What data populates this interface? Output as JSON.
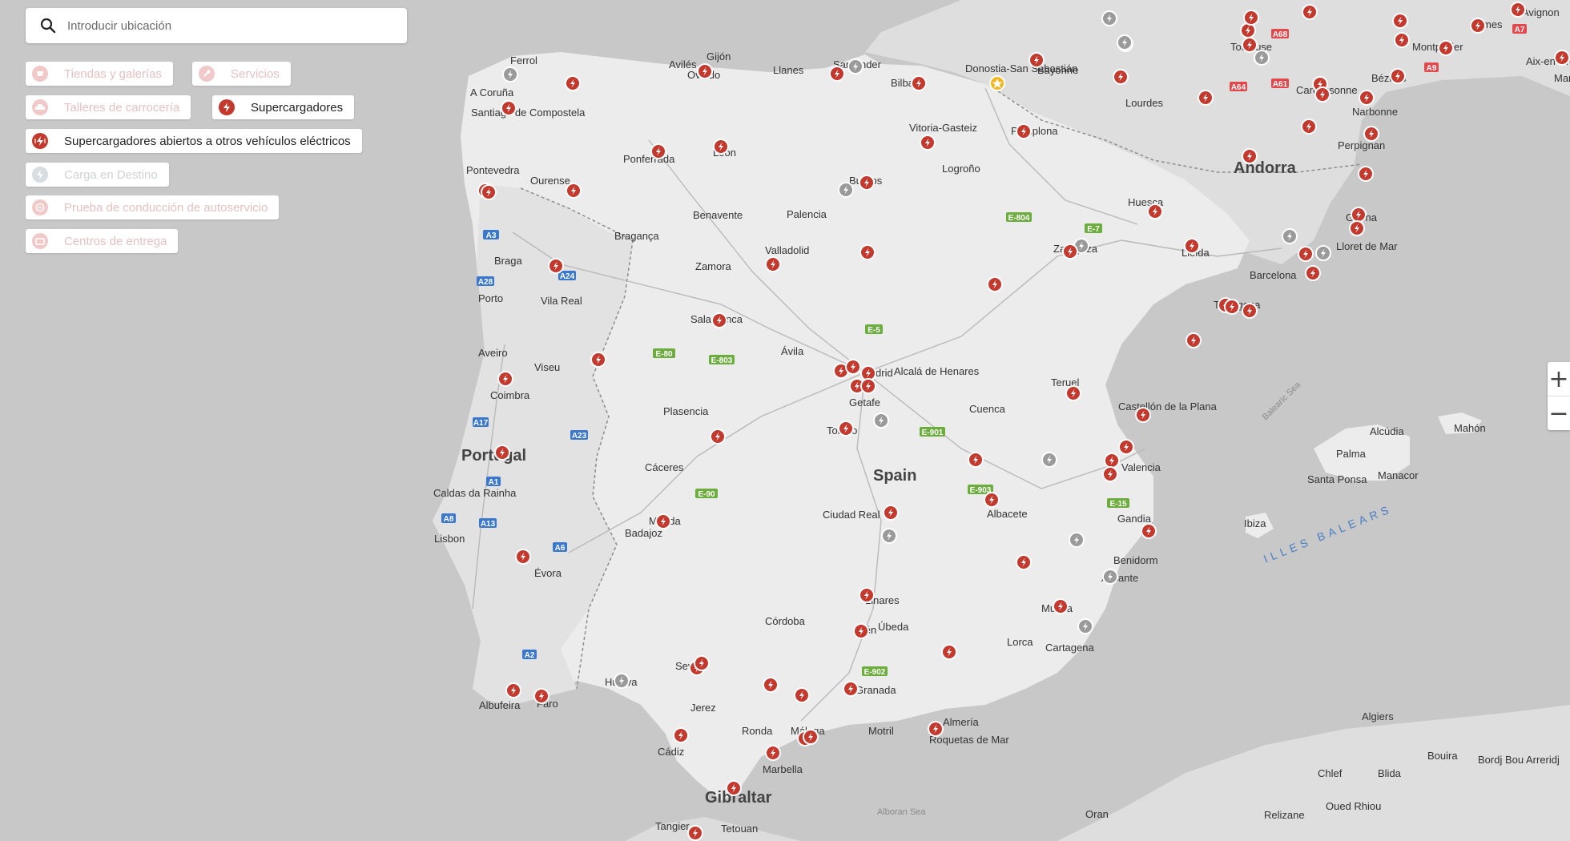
{
  "search": {
    "placeholder": "Introducir ubicación"
  },
  "filters": [
    {
      "label": "Tiendas y galerías",
      "active": false,
      "icon": "store-icon"
    },
    {
      "label": "Servicios",
      "active": false,
      "icon": "wrench-icon"
    },
    {
      "label": "Talleres de carrocería",
      "active": false,
      "icon": "car-body-icon"
    },
    {
      "label": "Supercargadores",
      "active": true,
      "icon": "bolt-icon"
    },
    {
      "label": "Supercargadores abiertos a otros vehículos eléctricos",
      "active": true,
      "icon": "bolt-open-icon"
    },
    {
      "label": "Carga en Destino",
      "active": false,
      "icon": "plug-icon"
    },
    {
      "label": "Prueba de conducción de autoservicio",
      "active": false,
      "icon": "steering-wheel-icon"
    },
    {
      "label": "Centros de entrega",
      "active": false,
      "icon": "delivery-icon"
    }
  ],
  "zoom": {
    "in": "+",
    "out": "−"
  },
  "colors": {
    "supercharger": "#c3392d",
    "destination": "#9a9a9a",
    "selected": "#f2b51b"
  },
  "map_labels": {
    "regions": [
      "Spain",
      "Portugal",
      "Andorra",
      "Gibraltar"
    ],
    "cities": [
      "A Coruña",
      "Ferrol",
      "Avilés",
      "Gijón",
      "Oviedo",
      "Llanes",
      "Santander",
      "Bilbao",
      "Donostia-San Sebastián",
      "Bayonne",
      "Vitoria-Gasteiz",
      "Pamplona",
      "Logroño",
      "Burgos",
      "Palencia",
      "Valladolid",
      "Zamora",
      "Salamanca",
      "Ávila",
      "Madrid",
      "Alcalá de Henares",
      "Getafe",
      "Toledo",
      "Cuenca",
      "Teruel",
      "Zaragoza",
      "Huesca",
      "Lleida",
      "Barcelona",
      "Tarragona",
      "Girona",
      "Lloret de Mar",
      "Perpignan",
      "Narbonne",
      "Montpellier",
      "Toulouse",
      "Carcassonne",
      "Béziers",
      "Lourdes",
      "Castellón de la Plana",
      "Valencia",
      "Gandia",
      "Benidorm",
      "Alicante",
      "Albacete",
      "Murcia",
      "Cartagena",
      "Lorca",
      "Almería",
      "Roquetas de Mar",
      "Granada",
      "Málaga",
      "Marbella",
      "Ronda",
      "Motril",
      "Córdoba",
      "Úbeda",
      "Linares",
      "Jaén",
      "Ciudad Real",
      "Sevilla",
      "Huelva",
      "Cádiz",
      "Jerez",
      "Tangier",
      "Tetouan",
      "Oran",
      "Algiers",
      "Chlef",
      "Blida",
      "Relizane",
      "Oued Rhiou",
      "Bouira",
      "Bordj Bou Arreridj",
      "Palma",
      "Alcúdia",
      "Manacor",
      "Santa Ponsa",
      "Mahón",
      "Ibiza",
      "Lisbon",
      "Porto",
      "Braga",
      "Coimbra",
      "Aveiro",
      "Viseu",
      "Évora",
      "Faro",
      "Albufeira",
      "Cáceres",
      "Mérida",
      "Badajoz",
      "Plasencia",
      "Bragança",
      "Vila Real",
      "Santiago de Compostela",
      "Pontevedra",
      "Ourense",
      "Ponferrada",
      "Benavente",
      "León",
      "Caldas da Rainha",
      "Aix-en-Provence",
      "Marseille",
      "Nîmes",
      "Avignon"
    ],
    "seas": [
      "Alboran Sea",
      "Balearic Sea",
      "ILLES BALEARS"
    ]
  },
  "road_shields": [
    "A3",
    "A28",
    "A24",
    "A17",
    "A23",
    "A1",
    "A8",
    "A13",
    "A6",
    "A2",
    "E-80",
    "E-5",
    "E-803",
    "E-90",
    "E-901",
    "E-903",
    "E-15",
    "E-804",
    "E-7",
    "E-902",
    "A64",
    "A61",
    "A68",
    "A9",
    "A7"
  ]
}
